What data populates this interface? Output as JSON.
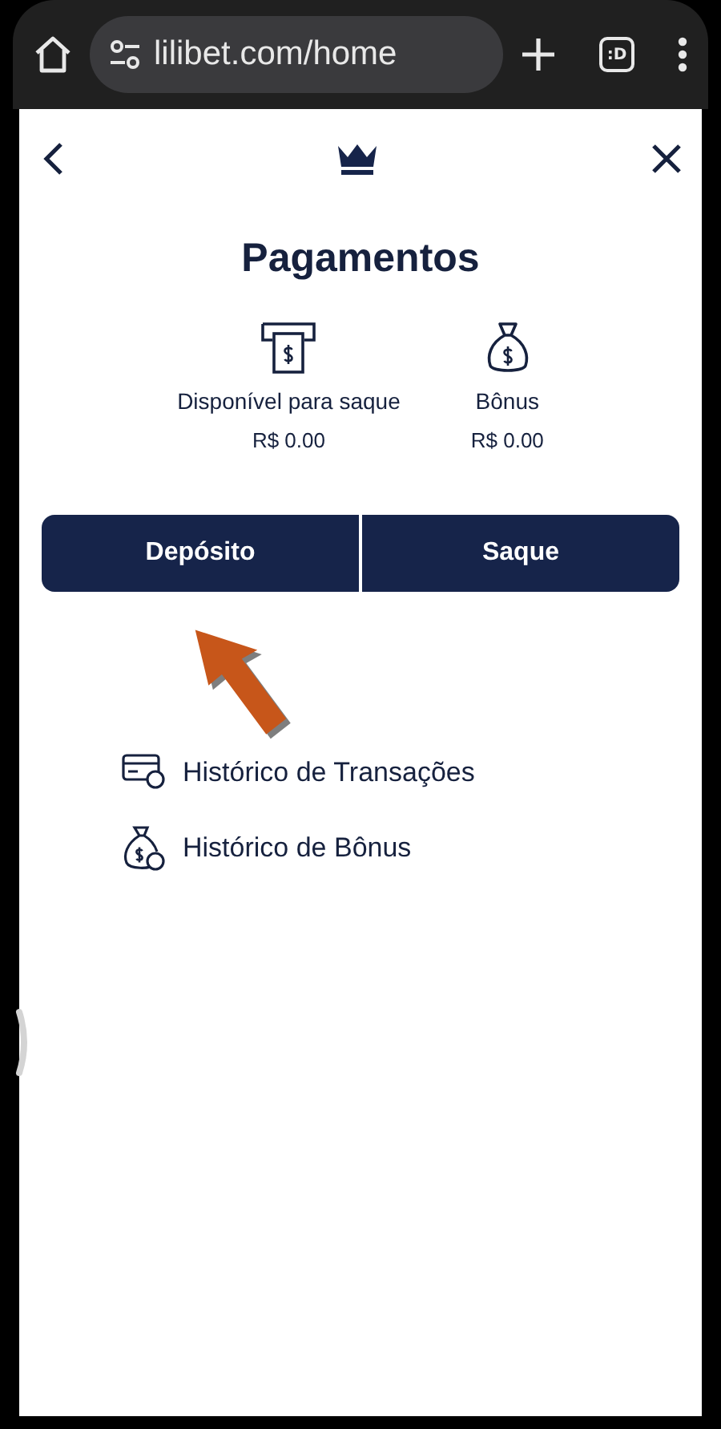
{
  "browser": {
    "url": "lilibet.com/home",
    "tab_count": ":D"
  },
  "page": {
    "title": "Pagamentos",
    "balances": [
      {
        "kind": "atm",
        "label": "Disponível para saque",
        "amount": "R$ 0.00"
      },
      {
        "kind": "bag",
        "label": "Bônus",
        "amount": "R$ 0.00"
      }
    ],
    "actions": [
      {
        "label": "Depósito"
      },
      {
        "label": "Saque"
      }
    ],
    "links": [
      {
        "kind": "card",
        "label": "Histórico de Transações"
      },
      {
        "kind": "bag",
        "label": "Histórico de Bônus"
      }
    ]
  }
}
